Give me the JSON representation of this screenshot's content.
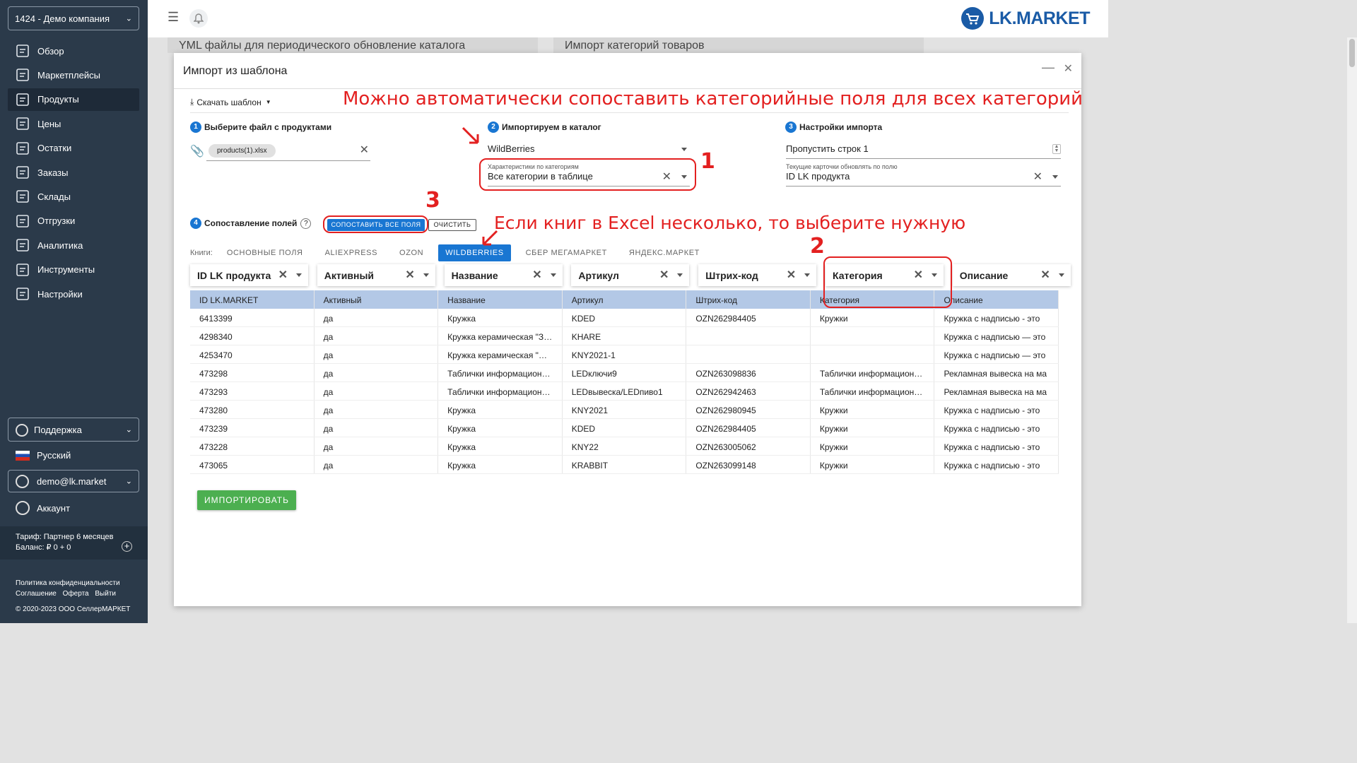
{
  "sidebar": {
    "company": "1424 - Демо компания",
    "items": [
      {
        "label": "Обзор",
        "icon": "overview-icon"
      },
      {
        "label": "Маркетплейсы",
        "icon": "marketplaces-icon"
      },
      {
        "label": "Продукты",
        "icon": "products-icon",
        "active": true
      },
      {
        "label": "Цены",
        "icon": "prices-icon"
      },
      {
        "label": "Остатки",
        "icon": "stock-icon"
      },
      {
        "label": "Заказы",
        "icon": "orders-icon"
      },
      {
        "label": "Склады",
        "icon": "warehouses-icon"
      },
      {
        "label": "Отгрузки",
        "icon": "shipments-icon"
      },
      {
        "label": "Аналитика",
        "icon": "analytics-icon"
      },
      {
        "label": "Инструменты",
        "icon": "tools-icon"
      },
      {
        "label": "Настройки",
        "icon": "settings-icon"
      }
    ],
    "support": "Поддержка",
    "language": "Русский",
    "user": "demo@lk.market",
    "account": "Аккаунт",
    "tariff": "Тариф: Партнер 6 месяцев",
    "balance": "Баланс: ₽ 0 + 0",
    "footer_links": [
      "Политика конфиденциальности",
      "Соглашение",
      "Оферта",
      "Выйти"
    ],
    "copyright": "© 2020-2023 ООО СеллерМАРКЕТ"
  },
  "topbar": {
    "logo": "LK.MARKET"
  },
  "background_cards": [
    "YML файлы для периодического обновление каталога",
    "Импорт категорий товаров"
  ],
  "modal": {
    "title": "Импорт из шаблона",
    "download_template": "Скачать шаблон",
    "step1": {
      "num": "1",
      "label": "Выберите файл с продуктами",
      "file": "products(1).xlsx"
    },
    "step2": {
      "num": "2",
      "label": "Импортируем в каталог",
      "catalog": "WildBerries",
      "char_label": "Характеристики по категориям",
      "char_value": "Все категории в таблице"
    },
    "step3": {
      "num": "3",
      "label": "Настройки импорта",
      "skip_rows": "Пропустить строк 1",
      "update_label": "Текущие карточки обновлять по полю",
      "update_value": "ID LK продукта"
    },
    "step4": {
      "num": "4",
      "label": "Сопоставление полей",
      "help": "?",
      "map_all": "СОПОСТАВИТЬ ВСЕ ПОЛЯ",
      "clear": "ОЧИСТИТЬ"
    },
    "books_label": "Книги:",
    "books": [
      "ОСНОВНЫЕ ПОЛЯ",
      "ALIEXPRESS",
      "OZON",
      "WILDBERRIES",
      "СБЕР МЕГАМАРКЕТ",
      "ЯНДЕКС.МАРКЕТ"
    ],
    "active_book": "WILDBERRIES",
    "column_mappings": [
      "ID LK продукта",
      "Активный",
      "Название",
      "Артикул",
      "Штрих-код",
      "Категория",
      "Описание"
    ],
    "table": {
      "headers": [
        "ID LK.MARKET",
        "Активный",
        "Название",
        "Артикул",
        "Штрих-код",
        "Категория",
        "Описание"
      ],
      "rows": [
        [
          "6413399",
          "да",
          "Кружка",
          "KDED",
          "OZN262984405",
          "Кружки",
          "Кружка с надписью - это"
        ],
        [
          "4298340",
          "да",
          "Кружка керамическая \"Злая",
          "KHARE",
          "",
          "",
          "Кружка с надписью — это"
        ],
        [
          "4253470",
          "да",
          "Кружка керамическая \"В нас",
          "KNY2021-1",
          "",
          "",
          "Кружка с надписью — это"
        ],
        [
          "473298",
          "да",
          "Таблички информационные",
          "LEDключи9",
          "OZN263098836",
          "Таблички информационные",
          "Рекламная вывеска на ма"
        ],
        [
          "473293",
          "да",
          "Таблички информационные",
          "LEDвывеска/LEDпиво1",
          "OZN262942463",
          "Таблички информационные",
          "Рекламная вывеска на ма"
        ],
        [
          "473280",
          "да",
          "Кружка",
          "KNY2021",
          "OZN262980945",
          "Кружки",
          "Кружка с надписью - это"
        ],
        [
          "473239",
          "да",
          "Кружка",
          "KDED",
          "OZN262984405",
          "Кружки",
          "Кружка с надписью - это"
        ],
        [
          "473228",
          "да",
          "Кружка",
          "KNY22",
          "OZN263005062",
          "Кружки",
          "Кружка с надписью - это"
        ],
        [
          "473065",
          "да",
          "Кружка",
          "KRABBIT",
          "OZN263099148",
          "Кружки",
          "Кружка с надписью - это"
        ]
      ]
    },
    "import_button": "ИМПОРТИРОВАТЬ"
  },
  "annotations": {
    "top": "Можно автоматически сопоставить категорийные поля для всех категорий",
    "books": "Если книг в Excel несколько, то выберите нужную",
    "n1": "1",
    "n2": "2",
    "n3": "3",
    "color": "#e32020"
  }
}
